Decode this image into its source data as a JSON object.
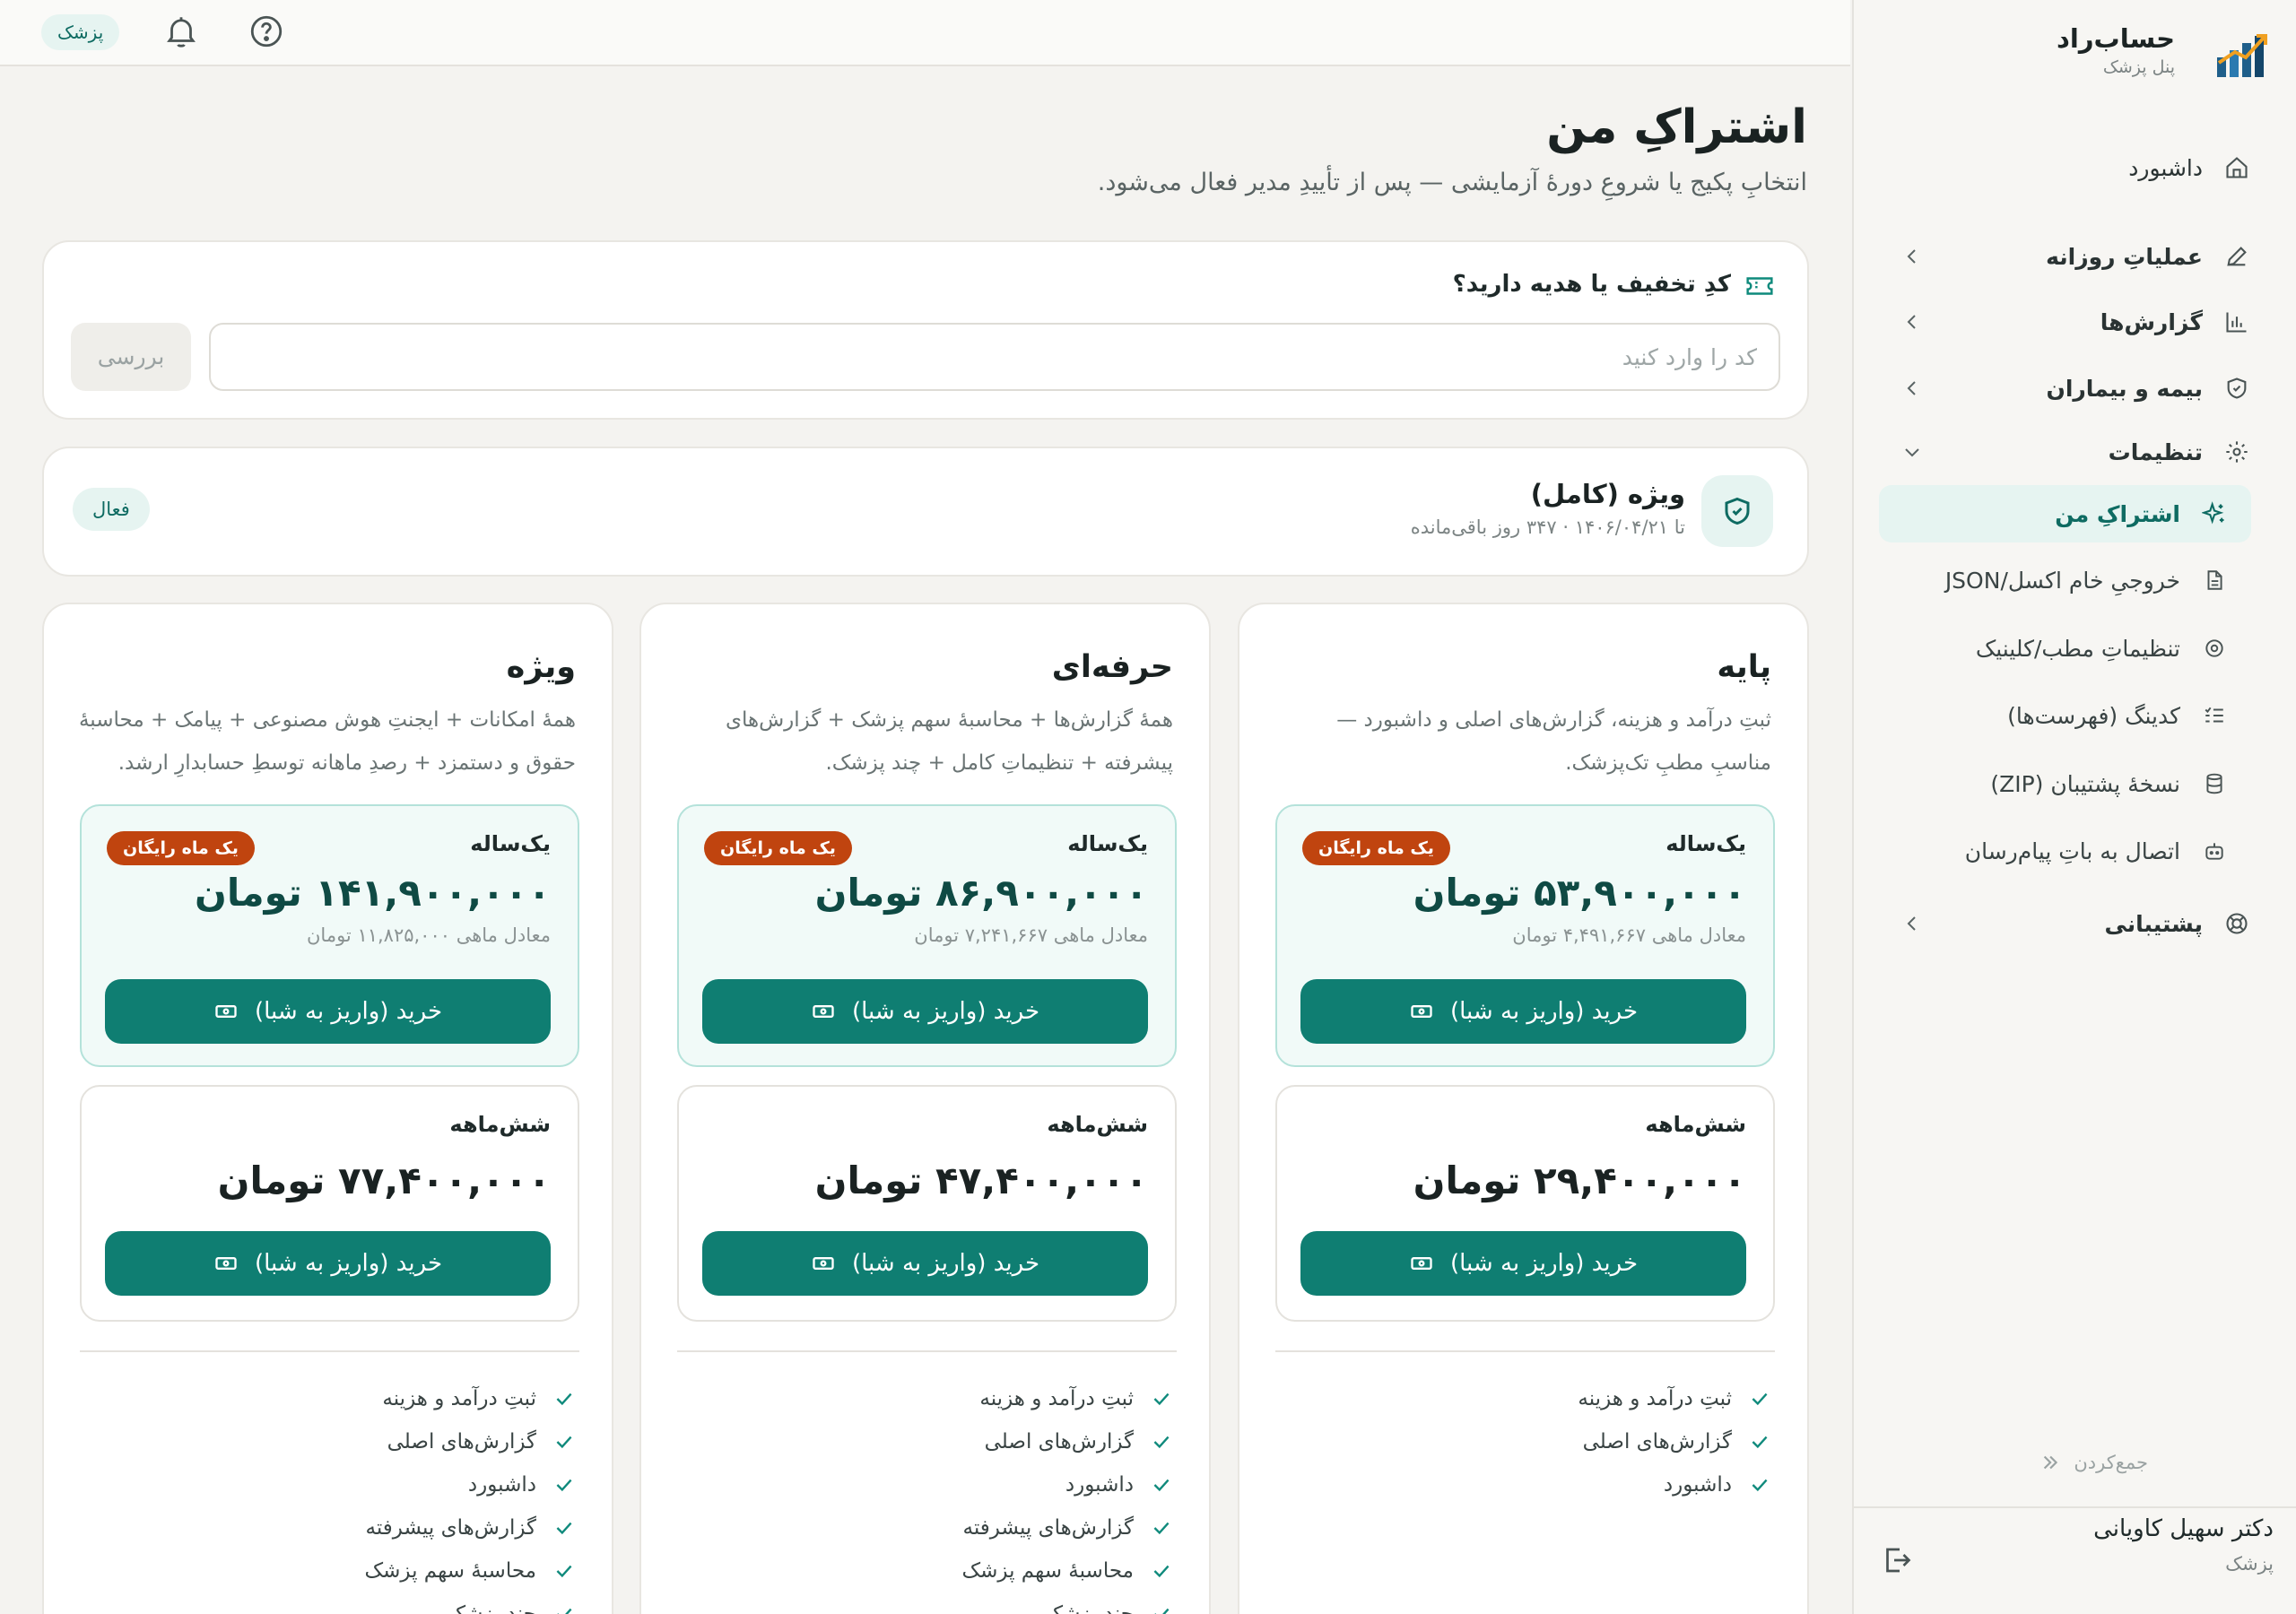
{
  "brand": {
    "title": "حساب‌راد",
    "subtitle": "پنل پزشک"
  },
  "topbar": {
    "role_badge": "پزشک",
    "icons": [
      "help-icon",
      "bell-icon"
    ]
  },
  "page": {
    "title": "اشتراکِ من",
    "subtitle": "انتخابِ پکیج یا شروعِ دورهٔ آزمایشی — پس از تأییدِ مدیر فعال می‌شود."
  },
  "discount": {
    "title": "کدِ تخفیف یا هدیه دارید؟",
    "placeholder": "کد را وارد کنید",
    "button": "بررسی"
  },
  "current_plan": {
    "name": "ویژه (کامل)",
    "meta": "تا ۱۴۰۶/۰۴/۲۱ · ۳۴۷ روز باقی‌مانده",
    "status": "فعال"
  },
  "sidebar": {
    "items": [
      {
        "label": "داشبورد",
        "icon": "home-icon"
      },
      {
        "label": "عملیاتِ روزانه",
        "icon": "pencil-icon"
      },
      {
        "label": "گزارش‌ها",
        "icon": "bar-chart-icon"
      },
      {
        "label": "بیمه و بیماران",
        "icon": "shield-icon"
      },
      {
        "label": "تنظیمات",
        "icon": "gear-icon"
      }
    ],
    "settings_sub": [
      {
        "label": "اشتراکِ من",
        "icon": "sparkle-icon",
        "active": true
      },
      {
        "label": "خروجیِ خام اکسل/JSON",
        "icon": "file-icon"
      },
      {
        "label": "تنظیماتِ مطب/کلینیک",
        "icon": "gear-icon"
      },
      {
        "label": "کدینگ (فهرست‌ها)",
        "icon": "list-check-icon"
      },
      {
        "label": "نسخهٔ پشتیبان (ZIP)",
        "icon": "database-icon"
      },
      {
        "label": "اتصال به باتِ پیام‌رسان",
        "icon": "bot-icon"
      }
    ],
    "support": {
      "label": "پشتیبانی",
      "icon": "lifebuoy-icon"
    },
    "collapse": "جمع‌کردن",
    "user": {
      "name": "دکتر سهیل کاویانی",
      "role": "پزشک"
    }
  },
  "plans": [
    {
      "name": "پایه",
      "description": "ثبتِ درآمد و هزینه، گزارش‌های اصلی و داشبورد — مناسبِ مطبِ تک‌پزشک.",
      "yearly": {
        "label": "یک‌ساله",
        "badge": "یک ماه رایگان",
        "price": "۵۳,۹۰۰,۰۰۰ تومان",
        "monthly": "معادل ماهی ۴,۴۹۱,۶۶۷ تومان",
        "button": "خرید (واریز به شبا)"
      },
      "half": {
        "label": "شش‌ماهه",
        "price": "۲۹,۴۰۰,۰۰۰ تومان",
        "button": "خرید (واریز به شبا)"
      },
      "features": [
        "ثبتِ درآمد و هزینه",
        "گزارش‌های اصلی",
        "داشبورد"
      ]
    },
    {
      "name": "حرفه‌ای",
      "description": "همهٔ گزارش‌ها + محاسبهٔ سهم پزشک + گزارش‌های پیشرفته + تنظیماتِ کامل + چند پزشک.",
      "yearly": {
        "label": "یک‌ساله",
        "badge": "یک ماه رایگان",
        "price": "۸۶,۹۰۰,۰۰۰ تومان",
        "monthly": "معادل ماهی ۷,۲۴۱,۶۶۷ تومان",
        "button": "خرید (واریز به شبا)"
      },
      "half": {
        "label": "شش‌ماهه",
        "price": "۴۷,۴۰۰,۰۰۰ تومان",
        "button": "خرید (واریز به شبا)"
      },
      "features": [
        "ثبتِ درآمد و هزینه",
        "گزارش‌های اصلی",
        "داشبورد",
        "گزارش‌های پیشرفته",
        "محاسبهٔ سهم پزشک",
        "چند پزشک"
      ]
    },
    {
      "name": "ویژه",
      "description": "همهٔ امکانات + ایجنتِ هوش مصنوعی + پیامک + محاسبهٔ حقوق و دستمزد + رصدِ ماهانه توسطِ حسابدارِ ارشد.",
      "yearly": {
        "label": "یک‌ساله",
        "badge": "یک ماه رایگان",
        "price": "۱۴۱,۹۰۰,۰۰۰ تومان",
        "monthly": "معادل ماهی ۱۱,۸۲۵,۰۰۰ تومان",
        "button": "خرید (واریز به شبا)"
      },
      "half": {
        "label": "شش‌ماهه",
        "price": "۷۷,۴۰۰,۰۰۰ تومان",
        "button": "خرید (واریز به شبا)"
      },
      "features": [
        "ثبتِ درآمد و هزینه",
        "گزارش‌های اصلی",
        "داشبورد",
        "گزارش‌های پیشرفته",
        "محاسبهٔ سهم پزشک",
        "چند پزشک"
      ]
    }
  ]
}
